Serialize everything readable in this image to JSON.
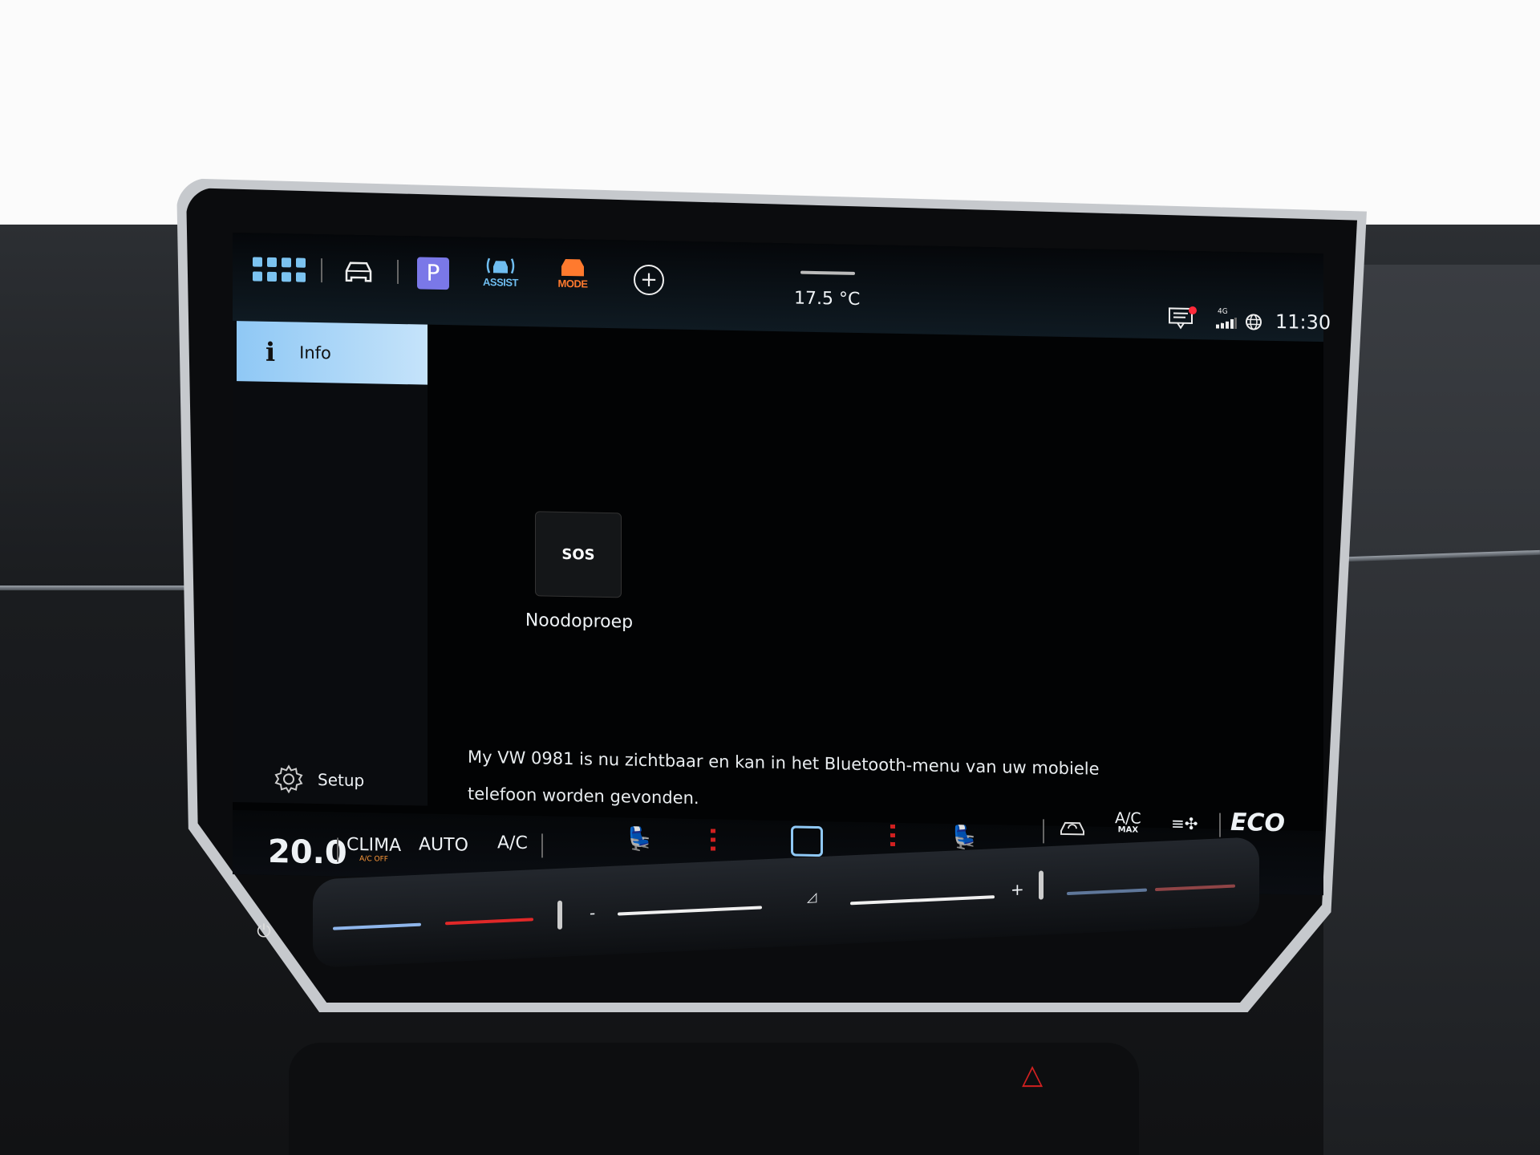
{
  "top_bar": {
    "icons": [
      "apps-grid-icon",
      "car-icon",
      "parking-icon",
      "assist-icon",
      "mode-icon",
      "add-icon"
    ],
    "parking_label": "P",
    "assist_label": "ASSIST",
    "mode_label": "MODE",
    "outside_temp": "17.5 °C",
    "network": "4G",
    "time": "11:30",
    "colors": {
      "apps": "#7cc3f0",
      "parking": "#7a78e8",
      "assist": "#6fbdf0",
      "mode": "#ff7a2e",
      "notification": "#ff2a3a"
    }
  },
  "sidebar": {
    "items": [
      {
        "label": "Info",
        "icon": "info-icon",
        "selected": true
      }
    ],
    "setup_label": "Setup"
  },
  "main": {
    "tiles": [
      {
        "label": "Noodoproep",
        "icon_text": "SOS",
        "icon": "sos-phone-icon"
      }
    ],
    "notification_line1": "My VW 0981 is nu zichtbaar en kan in het Bluetooth-menu van uw mobiele",
    "notification_line2": "telefoon worden gevonden."
  },
  "climate_bar": {
    "temperature": "20.0",
    "clima_label": "CLIMA",
    "clima_sub": "A/C OFF",
    "auto_label": "AUTO",
    "ac_label": "A/C",
    "ac_max_label": "A/C",
    "ac_max_sub": "MAX",
    "eco_label": "ECO",
    "slider_minus": "-",
    "slider_plus": "+"
  }
}
